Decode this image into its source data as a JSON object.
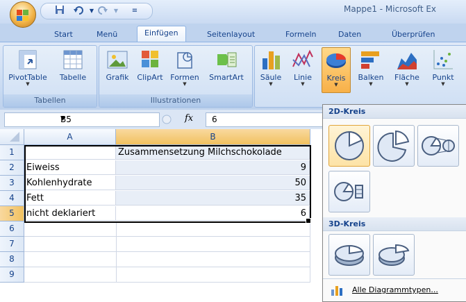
{
  "window": {
    "title": "Mappe1 - Microsoft Ex"
  },
  "tabs": [
    "Start",
    "Menü",
    "Einfügen",
    "Seitenlayout",
    "Formeln",
    "Daten",
    "Überprüfen"
  ],
  "ribbon": {
    "tabellen": {
      "label": "Tabellen",
      "buttons": [
        "PivotTable",
        "Tabelle"
      ]
    },
    "illustrationen": {
      "label": "Illustrationen",
      "buttons": [
        "Grafik",
        "ClipArt",
        "Formen",
        "SmartArt"
      ]
    },
    "diagramme": {
      "buttons": [
        "Säule",
        "Linie",
        "Kreis",
        "Balken",
        "Fläche",
        "Punkt"
      ]
    }
  },
  "formula_bar": {
    "name_box": "B5",
    "fx": "fx",
    "value": "6"
  },
  "sheet": {
    "columns": [
      "A",
      "B"
    ],
    "rows": [
      "1",
      "2",
      "3",
      "4",
      "5",
      "6",
      "7",
      "8",
      "9"
    ],
    "cells": {
      "B1": "Zusammensetzung Milchschokolade",
      "A2": "Eiweiss",
      "B2": "9",
      "A3": "Kohlenhydrate",
      "B3": "50",
      "A4": "Fett",
      "B4": "35",
      "A5": "nicht deklariert",
      "B5": "6"
    }
  },
  "dropdown": {
    "section_2d": "2D-Kreis",
    "section_3d": "3D-Kreis",
    "all_types": "Alle Diagrammtypen..."
  },
  "colors": {
    "accent_orange": "#f8b048",
    "ribbon_blue": "#c8daf2",
    "text_blue": "#15428b"
  }
}
